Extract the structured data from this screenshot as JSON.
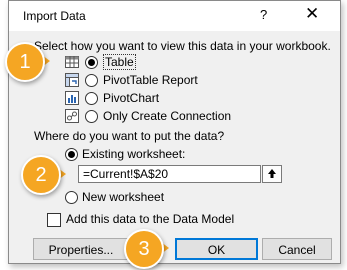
{
  "dialog": {
    "title": "Import Data",
    "help_glyph": "?",
    "close_glyph": "✕"
  },
  "view_section": {
    "prompt": "Select how you want to view this data in your workbook.",
    "options": [
      {
        "label": "Table",
        "selected": true,
        "icon": "table-icon"
      },
      {
        "label": "PivotTable Report",
        "selected": false,
        "icon": "pivottable-icon"
      },
      {
        "label": "PivotChart",
        "selected": false,
        "icon": "pivotchart-icon"
      },
      {
        "label": "Only Create Connection",
        "selected": false,
        "icon": "connection-icon"
      }
    ]
  },
  "location_section": {
    "prompt": "Where do you want to put the data?",
    "existing_label": "Existing worksheet:",
    "existing_selected": true,
    "range_value": "=Current!$A$20",
    "new_label": "New worksheet",
    "new_selected": false
  },
  "data_model": {
    "label": "Add this data to the Data Model",
    "checked": false
  },
  "buttons": {
    "properties": "Properties...",
    "ok": "OK",
    "cancel": "Cancel"
  },
  "callouts": [
    "1",
    "2",
    "3"
  ],
  "colors": {
    "callout": "#f5a623",
    "dialog_bg": "#f0f0f0",
    "primary_border": "#0078d7"
  }
}
